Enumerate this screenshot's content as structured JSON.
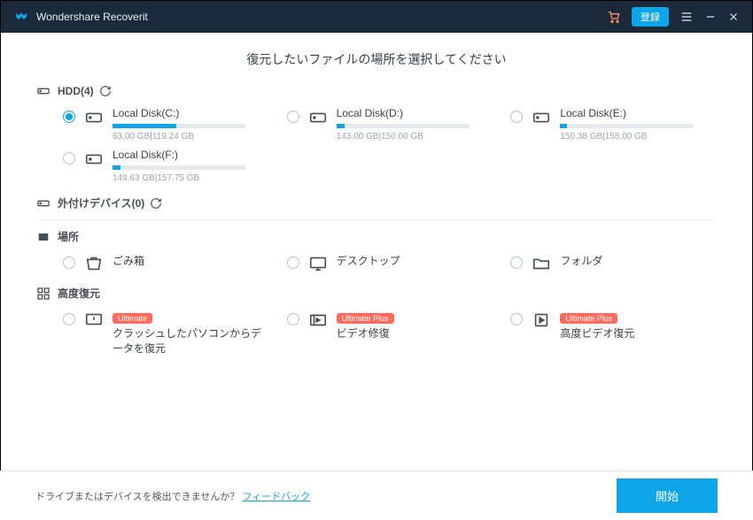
{
  "titlebar": {
    "title": "Wondershare Recoverit",
    "register": "登録"
  },
  "headline": "復元したいファイルの場所を選択してください",
  "sections": {
    "hdd": {
      "label": "HDD(4)"
    },
    "external": {
      "label": "外付けデバイス(0)"
    },
    "places": {
      "label": "場所"
    },
    "advanced": {
      "label": "高度復元"
    }
  },
  "disks": [
    {
      "label": "Local Disk(C:)",
      "sub": "63.00 GB|119.24 GB",
      "fill": 48,
      "selected": true
    },
    {
      "label": "Local Disk(D:)",
      "sub": "143.00 GB|150.00 GB",
      "fill": 6,
      "selected": false
    },
    {
      "label": "Local Disk(E:)",
      "sub": "150.38 GB|158.00 GB",
      "fill": 5,
      "selected": false
    },
    {
      "label": "Local Disk(F:)",
      "sub": "149.63 GB|157.75 GB",
      "fill": 6,
      "selected": false
    }
  ],
  "places": [
    {
      "label": "ごみ箱"
    },
    {
      "label": "デスクトップ"
    },
    {
      "label": "フォルダ"
    }
  ],
  "advanced": [
    {
      "badge": "Ultimate",
      "label": "クラッシュしたパソコンからデータを復元"
    },
    {
      "badge": "Ultimate Plus",
      "label": "ビデオ修復"
    },
    {
      "badge": "Ultimate Plus",
      "label": "高度ビデオ復元"
    }
  ],
  "footer": {
    "text": "ドライブまたはデバイスを検出できませんか？",
    "link": "フィードバック",
    "start": "開始"
  }
}
